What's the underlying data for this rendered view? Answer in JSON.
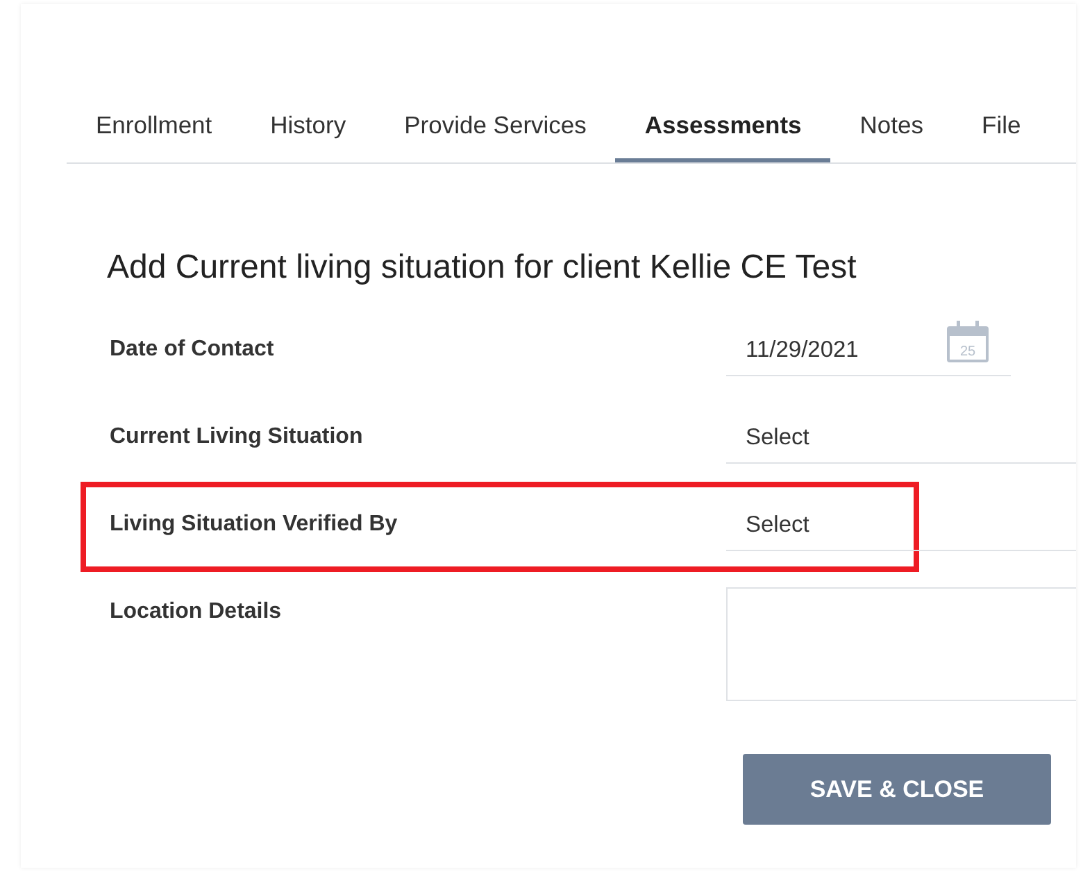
{
  "tabs": [
    {
      "label": "Enrollment",
      "selected": false
    },
    {
      "label": "History",
      "selected": false
    },
    {
      "label": "Provide Services",
      "selected": false
    },
    {
      "label": "Assessments",
      "selected": true
    },
    {
      "label": "Notes",
      "selected": false
    },
    {
      "label": "File",
      "selected": false
    }
  ],
  "heading": "Add Current living situation for client Kellie CE Test",
  "fields": [
    {
      "kind": "date",
      "label": "Date of Contact",
      "value": "11/29/2021",
      "calendar_day": "25",
      "highlighted": false
    },
    {
      "kind": "select",
      "label": "Current Living Situation",
      "value": "Select",
      "highlighted": false
    },
    {
      "kind": "select",
      "label": "Living Situation Verified By",
      "value": "Select",
      "highlighted": true
    },
    {
      "kind": "textarea",
      "label": "Location Details",
      "highlighted": false
    }
  ],
  "save_button": "SAVE & CLOSE"
}
